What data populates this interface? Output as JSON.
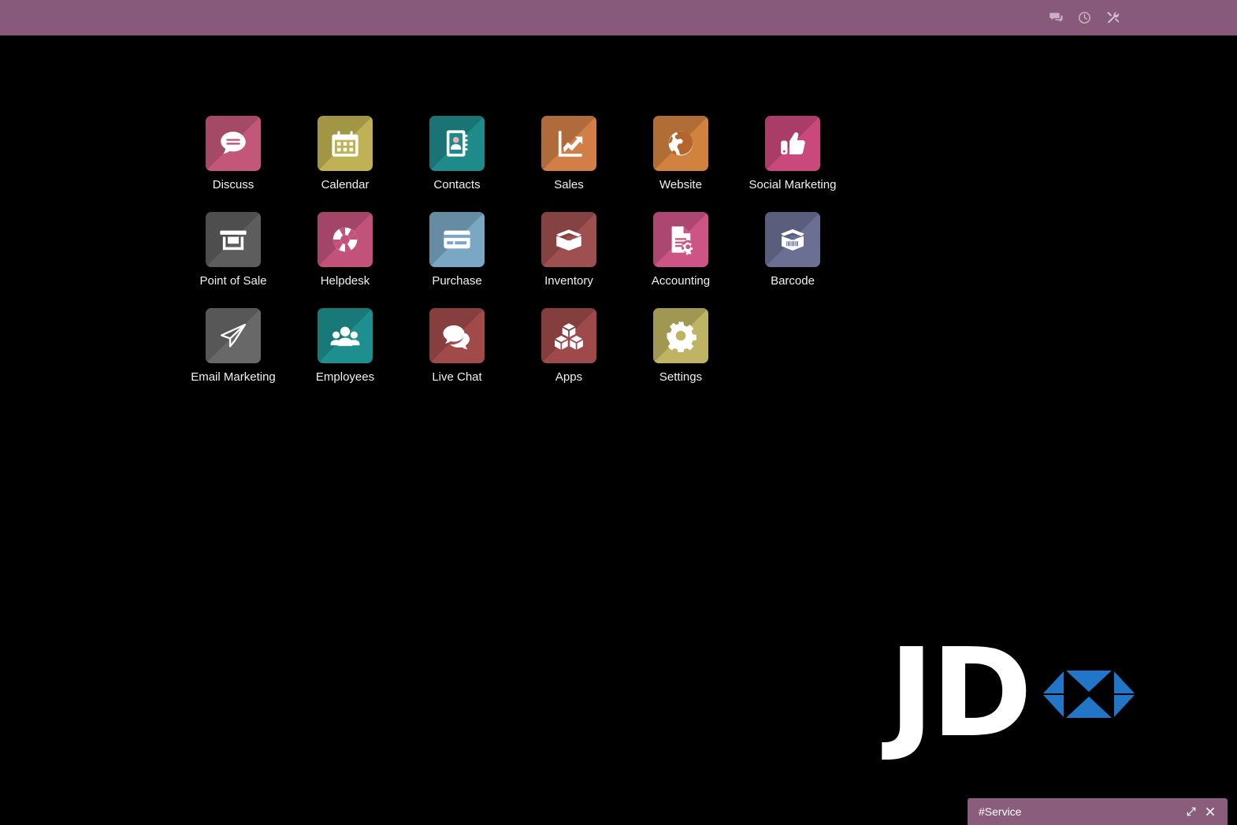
{
  "window": {
    "background_color": "#000000",
    "header_color": "#875a7b"
  },
  "header": {
    "icons": [
      {
        "name": "messages-icon",
        "title": "Messages"
      },
      {
        "name": "activities-clock-icon",
        "title": "Activities"
      },
      {
        "name": "tools-icon",
        "title": "Developer tools"
      }
    ]
  },
  "apps": {
    "rows": [
      [
        {
          "label": "Discuss",
          "icon": "discuss-icon",
          "color": "#c3577a"
        },
        {
          "label": "Calendar",
          "icon": "calendar-icon",
          "color": "#c0b254"
        },
        {
          "label": "Contacts",
          "icon": "contacts-icon",
          "color": "#1f8a8a"
        },
        {
          "label": "Sales",
          "icon": "sales-icon",
          "color": "#d27f47"
        },
        {
          "label": "Website",
          "icon": "website-globe-icon",
          "color": "#d2823f"
        },
        {
          "label": "Social Marketing",
          "icon": "thumbs-up-icon",
          "color": "#c9497c"
        }
      ],
      [
        {
          "label": "Point of Sale",
          "icon": "storefront-icon",
          "color": "#5d5d5d"
        },
        {
          "label": "Helpdesk",
          "icon": "lifebuoy-icon",
          "color": "#c2527a"
        },
        {
          "label": "Purchase",
          "icon": "credit-card-icon",
          "color": "#7aa7c4"
        },
        {
          "label": "Inventory",
          "icon": "open-box-icon",
          "color": "#9e4f4f"
        },
        {
          "label": "Accounting",
          "icon": "document-gear-icon",
          "color": "#cc5585"
        },
        {
          "label": "Barcode",
          "icon": "barcode-box-icon",
          "color": "#6b6f94"
        }
      ],
      [
        {
          "label": "Email Marketing",
          "icon": "paper-plane-icon",
          "color": "#686868"
        },
        {
          "label": "Employees",
          "icon": "people-group-icon",
          "color": "#1e8f8f"
        },
        {
          "label": "Live Chat",
          "icon": "chat-bubbles-icon",
          "color": "#a04a4a"
        },
        {
          "label": "Apps",
          "icon": "cubes-icon",
          "color": "#9e4a4a"
        },
        {
          "label": "Settings",
          "icon": "gear-icon",
          "color": "#bfb463"
        }
      ]
    ]
  },
  "branding": {
    "text": "JD",
    "mark_color": "#2176c7",
    "text_color": "#ffffff"
  },
  "taskbar": {
    "title": "#Service",
    "expand_label": "Expand",
    "close_label": "Close",
    "background_color": "#8a5d7c"
  }
}
